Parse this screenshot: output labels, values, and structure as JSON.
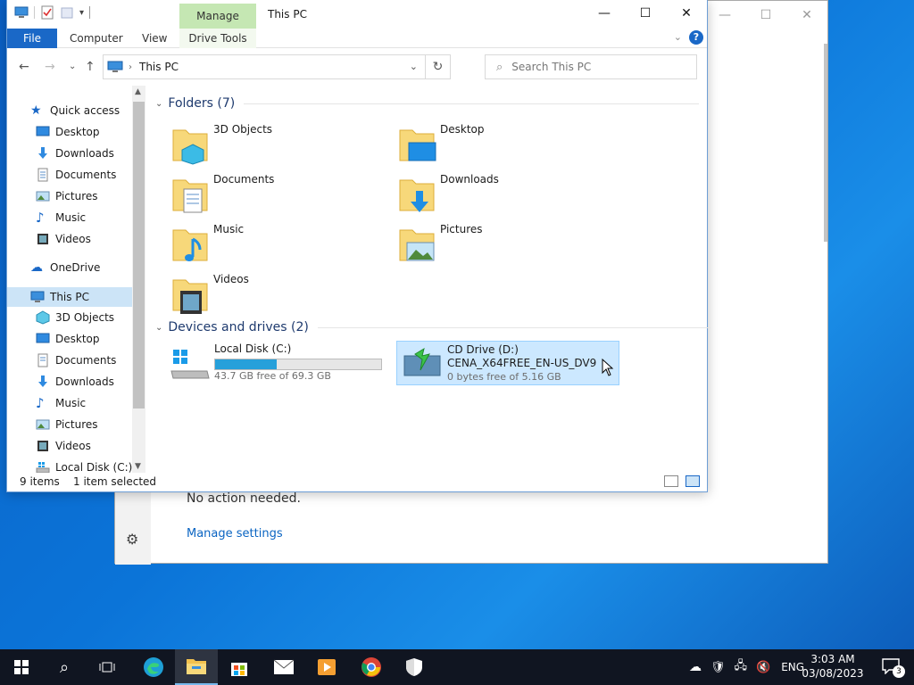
{
  "background_window": {
    "status_text": "No action needed.",
    "manage_link": "Manage settings"
  },
  "explorer": {
    "title": "This PC",
    "manage_tab": "Manage",
    "ribbon": {
      "file": "File",
      "computer": "Computer",
      "view": "View",
      "drive_tools": "Drive Tools",
      "help": "?"
    },
    "address": {
      "path": "This PC",
      "search_placeholder": "Search This PC"
    },
    "nav": {
      "quick_access": "Quick access",
      "quick_items": [
        {
          "label": "Desktop",
          "pinned": true
        },
        {
          "label": "Downloads",
          "pinned": true
        },
        {
          "label": "Documents",
          "pinned": true
        },
        {
          "label": "Pictures",
          "pinned": true
        },
        {
          "label": "Music",
          "pinned": false
        },
        {
          "label": "Videos",
          "pinned": false
        }
      ],
      "onedrive": "OneDrive",
      "this_pc": "This PC",
      "pc_items": [
        "3D Objects",
        "Desktop",
        "Documents",
        "Downloads",
        "Music",
        "Pictures",
        "Videos",
        "Local Disk (C:)"
      ]
    },
    "folders_header": "Folders (7)",
    "folders": [
      "3D Objects",
      "Desktop",
      "Documents",
      "Downloads",
      "Music",
      "Pictures",
      "Videos"
    ],
    "devices_header": "Devices and drives (2)",
    "drives": [
      {
        "name": "Local Disk (C:)",
        "free": "43.7 GB free of 69.3 GB",
        "used_fraction": 0.37
      },
      {
        "name": "CD Drive (D:)",
        "label": "CENA_X64FREE_EN-US_DV9",
        "free": "0 bytes free of 5.16 GB"
      }
    ],
    "status": {
      "items": "9 items",
      "selected": "1 item selected"
    }
  },
  "taskbar": {
    "apps": [
      "start-icon",
      "search-icon",
      "task-view-icon",
      "edge-icon",
      "file-explorer-icon",
      "store-icon",
      "mail-icon",
      "media-player-icon",
      "chrome-icon",
      "security-icon"
    ],
    "language": "ENG",
    "time": "3:03 AM",
    "date": "03/08/2023",
    "notification_count": "3"
  },
  "colors": {
    "accent": "#1a68c7",
    "manage_tab": "#c5e7b3",
    "selection": "#cce8ff",
    "drive_bar": "#26a0da",
    "taskbar": "#101521"
  }
}
